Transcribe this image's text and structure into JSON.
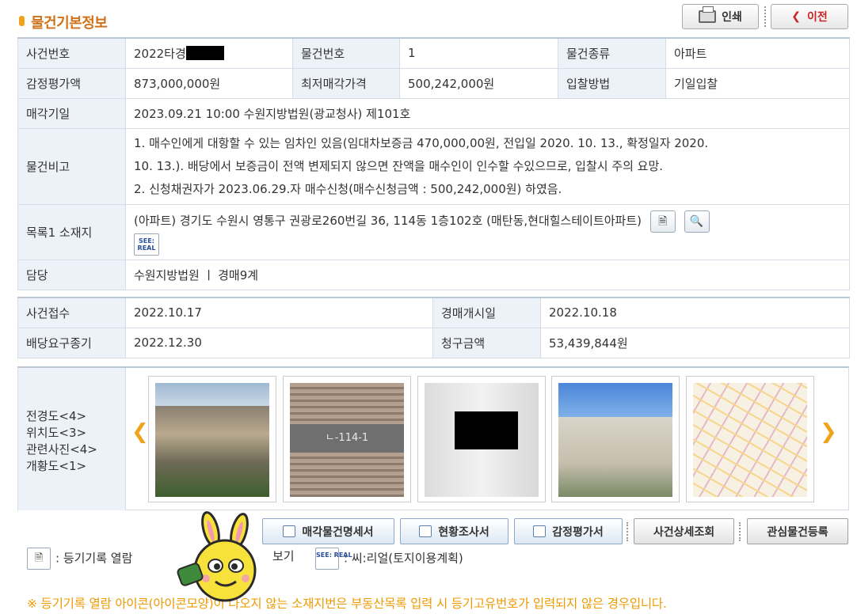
{
  "header": {
    "title": "물건기본정보",
    "print_label": "인쇄",
    "prev_label": "이전",
    "accent_color": "#d0721a"
  },
  "basic": {
    "case_no_label": "사건번호",
    "case_no_value": "2022타경",
    "item_no_label": "물건번호",
    "item_no_value": "1",
    "item_type_label": "물건종류",
    "item_type_value": "아파트",
    "appraisal_label": "감정평가액",
    "appraisal_value": "873,000,000원",
    "min_price_label": "최저매각가격",
    "min_price_value": "500,242,000원",
    "bid_method_label": "입찰방법",
    "bid_method_value": "기일입찰",
    "sale_date_label": "매각기일",
    "sale_date_value": "2023.09.21 10:00 수원지방법원(광교청사) 제101호",
    "remarks_label": "물건비고",
    "remarks_line1": "1. 매수인에게 대항할 수 있는 임차인 있음(임대차보증금 470,000,00원, 전입일 2020. 10. 13., 확정일자 2020.",
    "remarks_line2": "10. 13.). 배당에서 보증금이 전액 변제되지 않으면 잔액을 매수인이 인수할 수있으므로, 입찰시 주의 요망.",
    "remarks_line3": "2. 신청채권자가 2023.06.29.자 매수신청(매수신청금액 : 500,242,000원) 하였음.",
    "location_label": "목록1 소재지",
    "location_value": "(아파트) 경기도 수원시 영통구 권광로260번길 36, 114동 1층102호 (매탄동,현대힐스테이트아파트)",
    "charge_label": "담당",
    "charge_value": "수원지방법원 ㅣ 경매9계"
  },
  "case": {
    "received_label": "사건접수",
    "received_value": "2022.10.17",
    "start_label": "경매개시일",
    "start_value": "2022.10.18",
    "deadline_label": "배당요구종기",
    "deadline_value": "2022.12.30",
    "claim_label": "청구금액",
    "claim_value": "53,439,844원"
  },
  "gallery": {
    "label_exterior": "전경도<4>",
    "label_location": "위치도<3>",
    "label_related": "관련사진<4>",
    "label_overview": "개황도<1>",
    "sign_text": "ㄴ-114-1"
  },
  "actions": {
    "sale_statement": "매각물건명세서",
    "survey_report": "현황조사서",
    "appraisal_report": "감정평가서",
    "case_detail": "사건상세조회",
    "add_interest": "관심물건등록"
  },
  "legend": {
    "registry_text": ": 등기기록 열람",
    "map_text": "보기",
    "seereal_text": ": 씨:리얼(토지이용계획)",
    "see_badge": "SEE: REAL"
  },
  "notice": "※ 등기기록 열람 아이콘(아이콘모양)이 나오지 않는 소재지번은 부동산목록 입력 시 등기고유번호가 입력되지 않은 경우입니다."
}
